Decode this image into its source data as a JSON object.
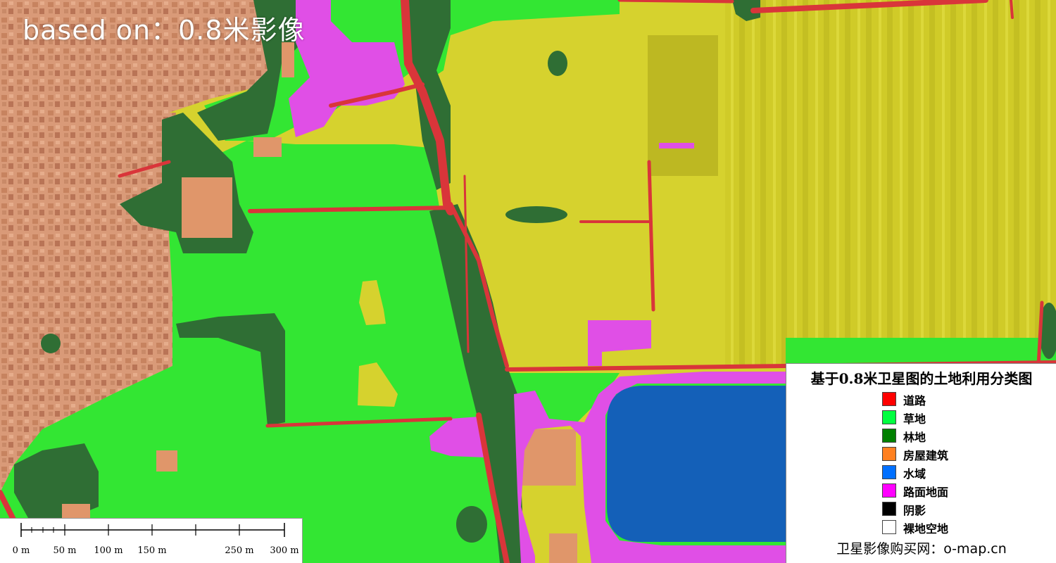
{
  "map": {
    "overlay_title": "based on：0.8米影像",
    "colors": {
      "urban": "#d99a78",
      "grass": "#33e633",
      "forest": "#2f6e34",
      "farmland": "#d6d22e",
      "road": "#d9353a",
      "pavement": "#e04fe6",
      "water": "#1460b8",
      "building": "#e0966a"
    }
  },
  "legend": {
    "title": "基于0.8米卫星图的土地利用分类图",
    "items": [
      {
        "label": "道路",
        "color": "#ff0000"
      },
      {
        "label": "草地",
        "color": "#00ff40"
      },
      {
        "label": "林地",
        "color": "#008000"
      },
      {
        "label": "房屋建筑",
        "color": "#ff8020"
      },
      {
        "label": "水域",
        "color": "#0070ff"
      },
      {
        "label": "路面地面",
        "color": "#ff00ff"
      },
      {
        "label": "阴影",
        "color": "#000000"
      },
      {
        "label": "裸地空地",
        "color": "#ffffff"
      }
    ],
    "footer": "卫星影像购买网：o-map.cn"
  },
  "scalebar": {
    "labels": [
      "0 m",
      "50 m",
      "100 m",
      "150 m",
      "250 m",
      "300 m"
    ]
  }
}
